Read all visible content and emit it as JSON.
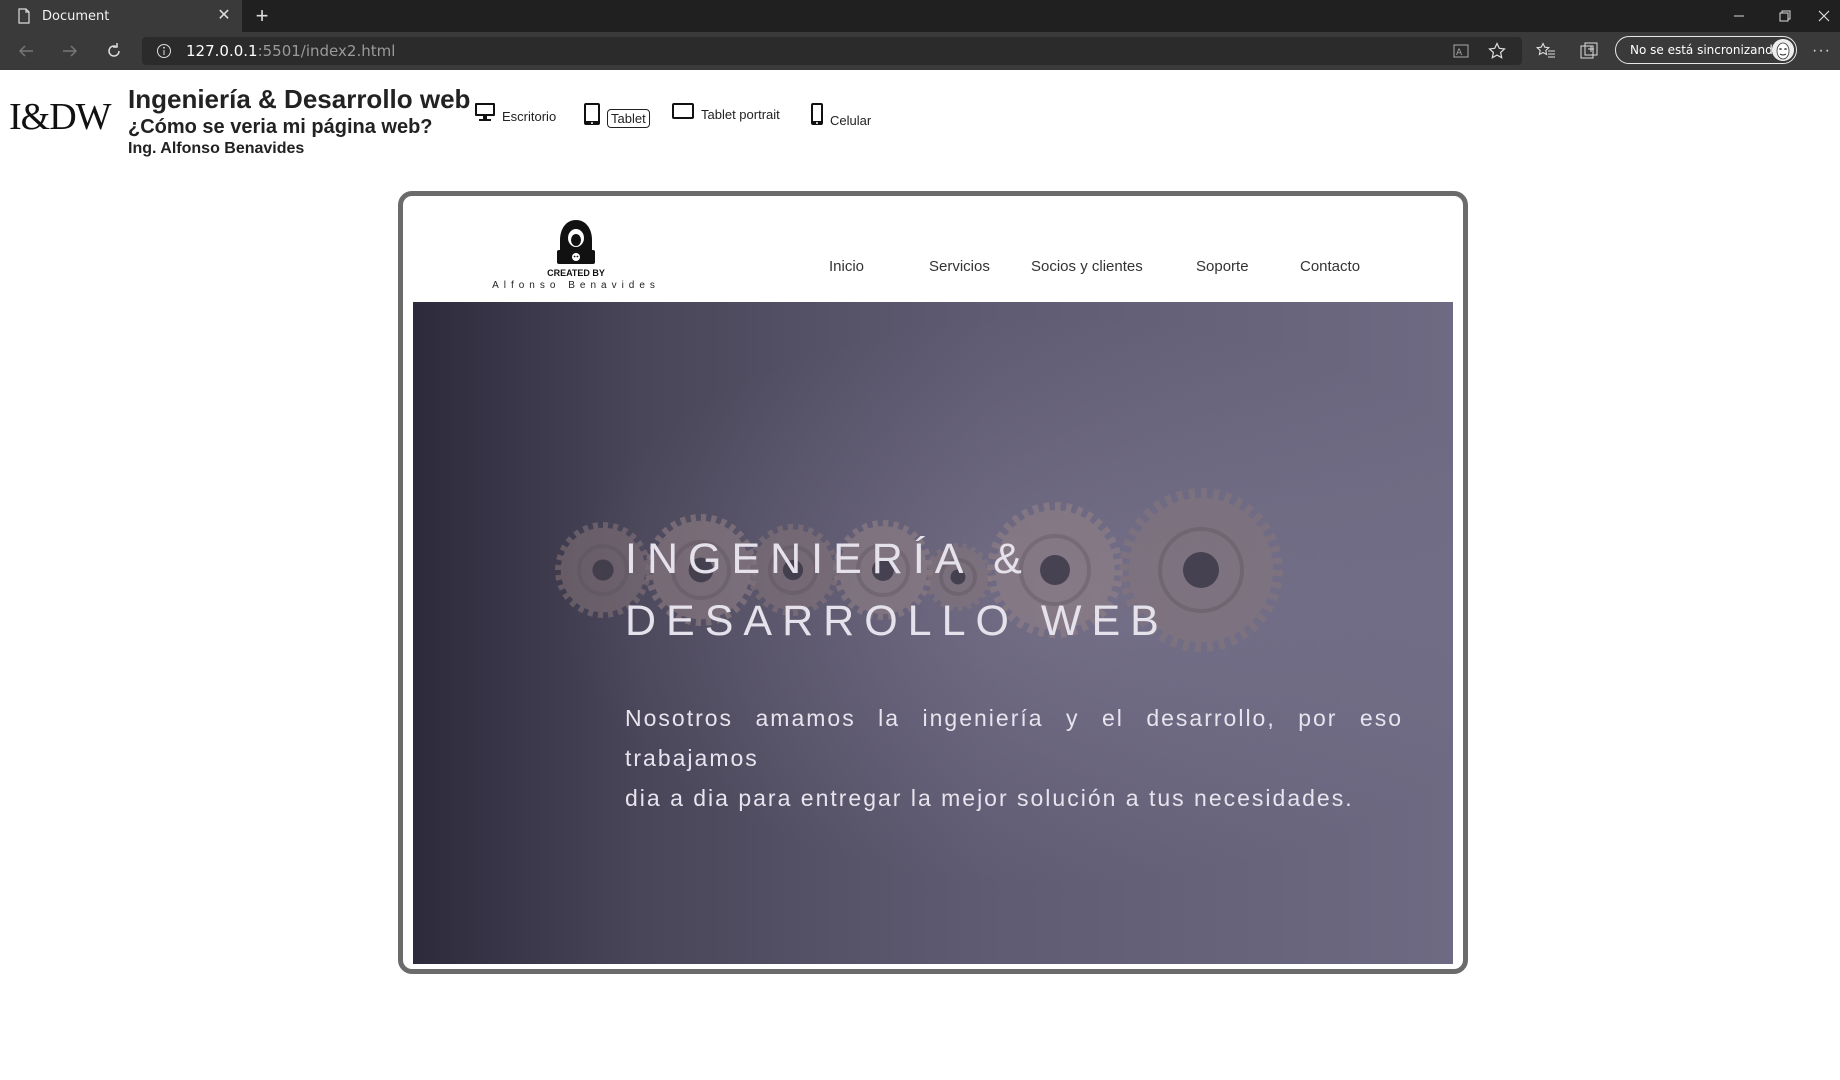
{
  "browser": {
    "tab_title": "Document",
    "url_host": "127.0.0.1",
    "url_rest": ":5501/index2.html",
    "sync_label": "No se está sincronizando"
  },
  "header": {
    "logo": "I&DW",
    "title": "Ingeniería & Desarrollo web",
    "subtitle": "¿Cómo se veria mi página web?",
    "author": "Ing. Alfonso Benavides"
  },
  "devices": [
    {
      "label": "Escritorio",
      "icon": "desktop-icon",
      "active": false
    },
    {
      "label": "Tablet",
      "icon": "tablet-icon",
      "active": true
    },
    {
      "label": "Tablet portrait",
      "icon": "tablet-landscape-icon",
      "active": false
    },
    {
      "label": "Celular",
      "icon": "phone-icon",
      "active": false
    }
  ],
  "preview": {
    "brand": {
      "line1": "CREATED BY",
      "line2": "Alfonso Benavides"
    },
    "nav": [
      "Inicio",
      "Servicios",
      "Socios y clientes",
      "Soporte",
      "Contacto"
    ],
    "hero": {
      "title_line1": "INGENIERÍA &",
      "title_line2": "DESARROLLO WEB",
      "text_line1": "Nosotros amamos la ingeniería y el desarrollo, por eso trabajamos",
      "text_line2": "dia a dia para entregar la mejor solución a tus necesidades."
    }
  },
  "colors": {
    "chrome_dark": "#202020",
    "chrome_mid": "#3a3a3a",
    "frame": "#6b6b6b",
    "hero_dark": "#2d2a3c",
    "hero_light": "#6e6a83"
  }
}
